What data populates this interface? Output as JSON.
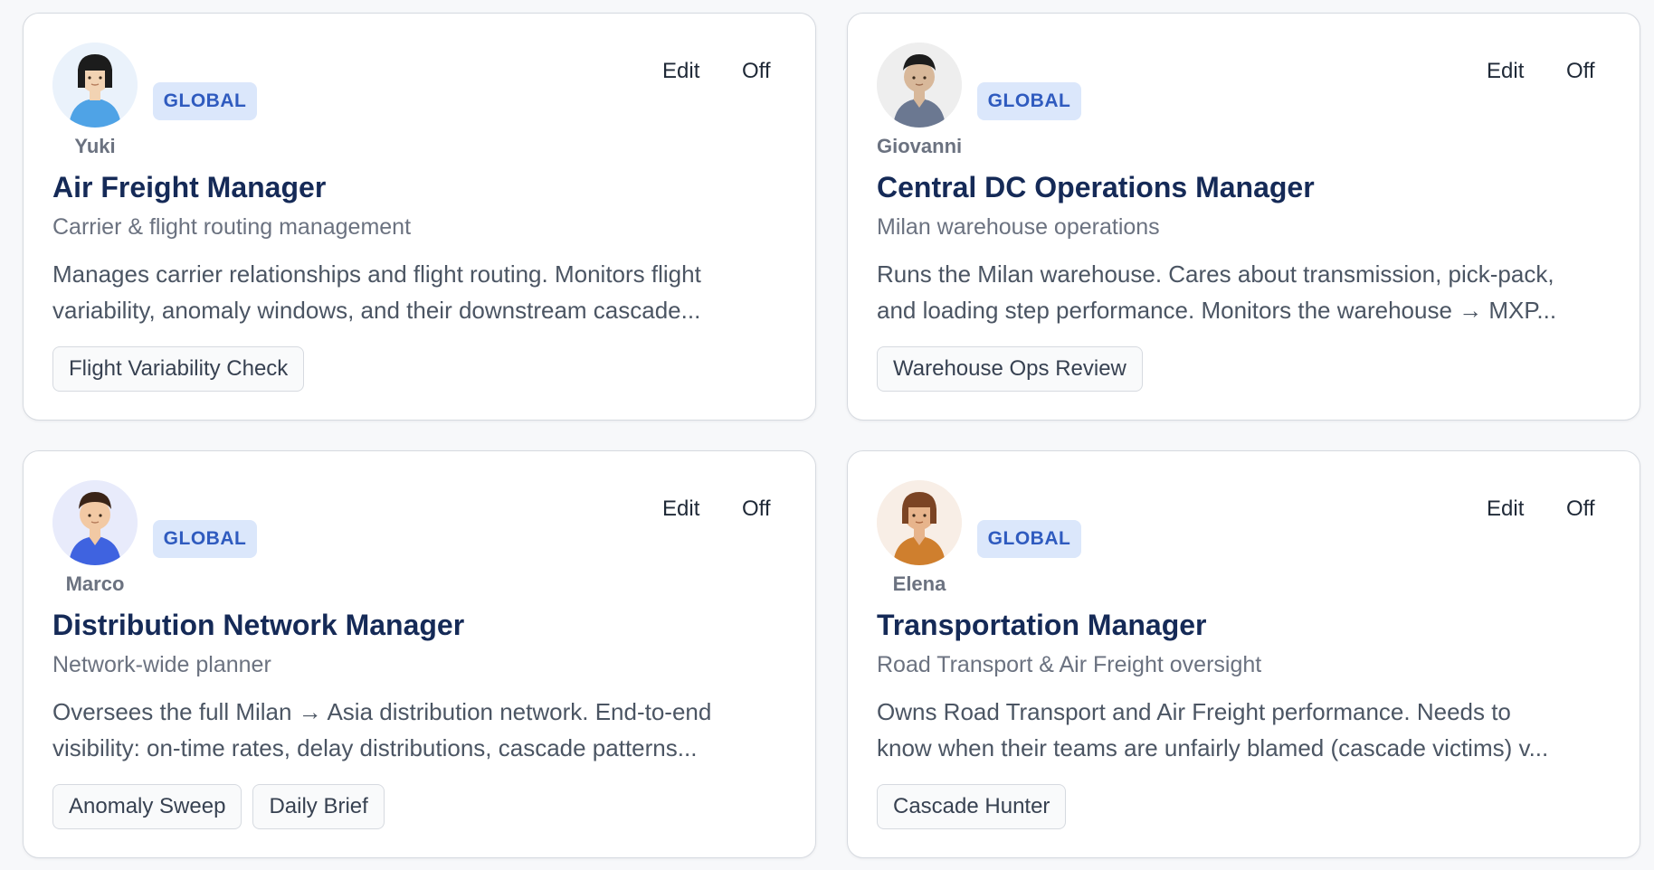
{
  "cards": [
    {
      "avatar_name": "Yuki",
      "avatar_icon": "person-avatar-icon",
      "avatar_bg": "#eaf2fb",
      "badge": "GLOBAL",
      "edit_label": "Edit",
      "toggle_label": "Off",
      "title": "Air Freight Manager",
      "subtitle": "Carrier & flight routing management",
      "description_lines": [
        "Manages carrier relationships and flight routing. Monitors flight",
        "variability, anomaly windows, and their downstream cascade..."
      ],
      "tags": [
        "Flight Variability Check"
      ]
    },
    {
      "avatar_name": "Giovanni",
      "avatar_icon": "person-avatar-icon",
      "avatar_bg": "#eeeeee",
      "badge": "GLOBAL",
      "edit_label": "Edit",
      "toggle_label": "Off",
      "title": "Central DC Operations Manager",
      "subtitle": "Milan warehouse operations",
      "description_lines": [
        "Runs the Milan warehouse. Cares about transmission, pick-pack,",
        "and loading step performance. Monitors the warehouse → MXP..."
      ],
      "tags": [
        "Warehouse Ops Review"
      ]
    },
    {
      "avatar_name": "Marco",
      "avatar_icon": "person-avatar-icon",
      "avatar_bg": "#e8ebfb",
      "badge": "GLOBAL",
      "edit_label": "Edit",
      "toggle_label": "Off",
      "title": "Distribution Network Manager",
      "subtitle": "Network-wide planner",
      "description_lines": [
        "Oversees the full Milan → Asia distribution network. End-to-end",
        "visibility: on-time rates, delay distributions, cascade patterns..."
      ],
      "tags": [
        "Anomaly Sweep",
        "Daily Brief"
      ]
    },
    {
      "avatar_name": "Elena",
      "avatar_icon": "person-avatar-icon",
      "avatar_bg": "#f8eee6",
      "badge": "GLOBAL",
      "edit_label": "Edit",
      "toggle_label": "Off",
      "title": "Transportation Manager",
      "subtitle": "Road Transport & Air Freight oversight",
      "description_lines": [
        "Owns Road Transport and Air Freight performance. Needs to",
        "know when their teams are unfairly blamed (cascade victims) v..."
      ],
      "tags": [
        "Cascade Hunter"
      ]
    }
  ],
  "colors": {
    "title": "#152a57",
    "badge_bg": "#dbe7fb",
    "badge_text": "#2f5bbf",
    "card_border": "#d6dae0"
  }
}
